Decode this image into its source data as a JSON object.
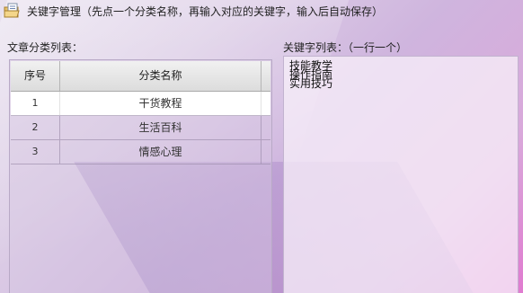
{
  "window": {
    "title": "关键字管理（先点一个分类名称，再输入对应的关键字，输入后自动保存）",
    "icon": "folder-notes-icon"
  },
  "category_panel": {
    "label": "文章分类列表：",
    "columns": [
      "序号",
      "分类名称"
    ],
    "rows": [
      {
        "no": "1",
        "name": "干货教程",
        "selected": true
      },
      {
        "no": "2",
        "name": "生活百科",
        "selected": false
      },
      {
        "no": "3",
        "name": "情感心理",
        "selected": false
      }
    ]
  },
  "keyword_panel": {
    "label": "关键字列表：（一行一个）",
    "value": "技能教学\n操作指南\n实用技巧"
  }
}
